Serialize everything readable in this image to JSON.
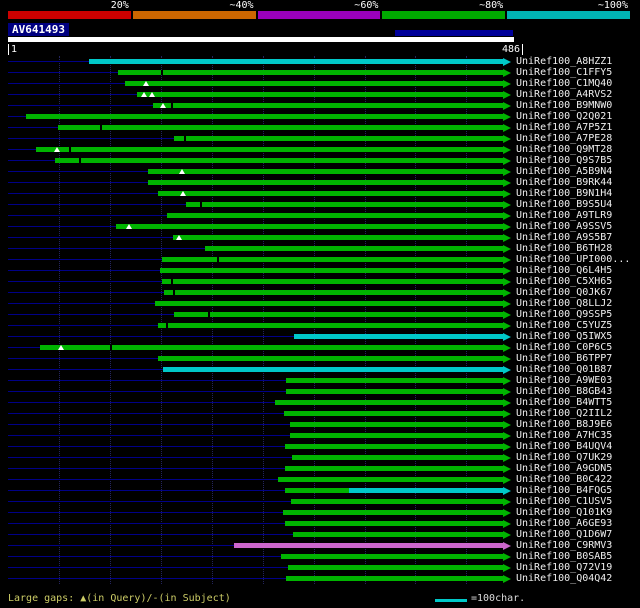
{
  "colors": {
    "background": "#000000",
    "green": "#00b400",
    "cyan": "#00c8c8",
    "magenta": "#cc66cc",
    "navy_line": "#000088",
    "query_bar": "#ffffff",
    "legend_text": "#cccc66"
  },
  "scale": {
    "segments": [
      {
        "label": "20%",
        "color": "#cc0000"
      },
      {
        "label": "~40%",
        "color": "#cc6600"
      },
      {
        "label": "~60%",
        "color": "#9900bb"
      },
      {
        "label": "~80%",
        "color": "#00aa00"
      },
      {
        "label": "~100%",
        "color": "#00b4b4"
      }
    ]
  },
  "query": {
    "name": "AV641493",
    "start_label": "1",
    "end_label": "486"
  },
  "legend": {
    "gaps": "Large gaps: ▲(in Query)/-(in Subject)",
    "unit": "=100char."
  },
  "chart_data": {
    "type": "bar",
    "subtype": "horizontal-alignment-spans",
    "title": "AV641493",
    "xlabel": "query position",
    "xlim": [
      1,
      486
    ],
    "grid_interval": 50,
    "legend_position": "top",
    "hits": [
      {
        "label": "UniRef100_A8HZZ1",
        "segments": [
          {
            "color": "cyan",
            "start": 79,
            "end": 486
          }
        ]
      },
      {
        "label": "UniRef100_C1FFY5",
        "segments": [
          {
            "color": "green",
            "start": 108,
            "end": 486
          }
        ],
        "s_gaps": [
          150
        ]
      },
      {
        "label": "UniRef100_C1MQ40",
        "segments": [
          {
            "color": "green",
            "start": 115,
            "end": 486
          }
        ],
        "q_gaps": [
          135
        ]
      },
      {
        "label": "UniRef100_A4RVS2",
        "segments": [
          {
            "color": "green",
            "start": 127,
            "end": 486
          }
        ],
        "q_gaps": [
          133,
          141
        ]
      },
      {
        "label": "UniRef100_B9MNW0",
        "segments": [
          {
            "color": "green",
            "start": 142,
            "end": 486
          }
        ],
        "q_gaps": [
          152
        ],
        "s_gaps": [
          160
        ]
      },
      {
        "label": "UniRef100_Q2Q021",
        "segments": [
          {
            "color": "green",
            "start": 18,
            "end": 486
          }
        ]
      },
      {
        "label": "UniRef100_A7P5Z1",
        "segments": [
          {
            "color": "green",
            "start": 49,
            "end": 486
          }
        ],
        "s_gaps": [
          90
        ]
      },
      {
        "label": "UniRef100_A7PE28",
        "segments": [
          {
            "color": "green",
            "start": 163,
            "end": 486
          }
        ],
        "s_gaps": [
          173
        ]
      },
      {
        "label": "UniRef100_Q9MT28",
        "segments": [
          {
            "color": "green",
            "start": 27,
            "end": 486
          }
        ],
        "q_gaps": [
          48
        ],
        "s_gaps": [
          60
        ]
      },
      {
        "label": "UniRef100_Q9S7B5",
        "segments": [
          {
            "color": "green",
            "start": 46,
            "end": 486
          }
        ],
        "s_gaps": [
          70
        ]
      },
      {
        "label": "UniRef100_A5B9N4",
        "segments": [
          {
            "color": "green",
            "start": 137,
            "end": 486
          }
        ],
        "q_gaps": [
          171
        ]
      },
      {
        "label": "UniRef100_B9RK44",
        "segments": [
          {
            "color": "green",
            "start": 137,
            "end": 486
          }
        ]
      },
      {
        "label": "UniRef100_B9N1H4",
        "segments": [
          {
            "color": "green",
            "start": 147,
            "end": 486
          }
        ],
        "q_gaps": [
          172
        ]
      },
      {
        "label": "UniRef100_B9S5U4",
        "segments": [
          {
            "color": "green",
            "start": 175,
            "end": 486
          }
        ],
        "s_gaps": [
          188
        ]
      },
      {
        "label": "UniRef100_A9TLR9",
        "segments": [
          {
            "color": "green",
            "start": 156,
            "end": 486
          }
        ]
      },
      {
        "label": "UniRef100_A9SSV5",
        "segments": [
          {
            "color": "green",
            "start": 106,
            "end": 486
          }
        ],
        "q_gaps": [
          119
        ]
      },
      {
        "label": "UniRef100_A9S5B7",
        "segments": [
          {
            "color": "green",
            "start": 162,
            "end": 486
          }
        ],
        "q_gaps": [
          168
        ]
      },
      {
        "label": "UniRef100_B6TH28",
        "segments": [
          {
            "color": "green",
            "start": 193,
            "end": 486
          }
        ]
      },
      {
        "label": "UniRef100_UPI000...",
        "segments": [
          {
            "color": "green",
            "start": 151,
            "end": 486
          }
        ],
        "s_gaps": [
          205
        ]
      },
      {
        "label": "UniRef100_Q6L4H5",
        "segments": [
          {
            "color": "green",
            "start": 149,
            "end": 486
          }
        ]
      },
      {
        "label": "UniRef100_C5XH65",
        "segments": [
          {
            "color": "green",
            "start": 151,
            "end": 486
          }
        ],
        "s_gaps": [
          160
        ]
      },
      {
        "label": "UniRef100_Q0JK67",
        "segments": [
          {
            "color": "green",
            "start": 153,
            "end": 486
          }
        ],
        "s_gaps": [
          162
        ]
      },
      {
        "label": "UniRef100_Q8LLJ2",
        "segments": [
          {
            "color": "green",
            "start": 144,
            "end": 486
          }
        ]
      },
      {
        "label": "UniRef100_Q9SSP5",
        "segments": [
          {
            "color": "green",
            "start": 163,
            "end": 486
          }
        ],
        "s_gaps": [
          196
        ]
      },
      {
        "label": "UniRef100_C5YUZ5",
        "segments": [
          {
            "color": "green",
            "start": 147,
            "end": 486
          }
        ],
        "s_gaps": [
          155
        ]
      },
      {
        "label": "UniRef100_Q5IWX5",
        "segments": [
          {
            "color": "cyan",
            "start": 281,
            "end": 486
          }
        ]
      },
      {
        "label": "UniRef100_C0P6C5",
        "segments": [
          {
            "color": "green",
            "start": 31,
            "end": 486
          }
        ],
        "q_gaps": [
          52
        ],
        "s_gaps": [
          100
        ]
      },
      {
        "label": "UniRef100_B6TPP7",
        "segments": [
          {
            "color": "green",
            "start": 147,
            "end": 486
          }
        ]
      },
      {
        "label": "UniRef100_Q01B87",
        "segments": [
          {
            "color": "cyan",
            "start": 152,
            "end": 486
          }
        ]
      },
      {
        "label": "UniRef100_A9WE03",
        "segments": [
          {
            "color": "green",
            "start": 273,
            "end": 486
          }
        ]
      },
      {
        "label": "UniRef100_B8GB43",
        "segments": [
          {
            "color": "green",
            "start": 273,
            "end": 486
          }
        ]
      },
      {
        "label": "UniRef100_B4WTT5",
        "segments": [
          {
            "color": "green",
            "start": 262,
            "end": 486
          }
        ]
      },
      {
        "label": "UniRef100_Q2IIL2",
        "segments": [
          {
            "color": "green",
            "start": 271,
            "end": 486
          }
        ]
      },
      {
        "label": "UniRef100_B8J9E6",
        "segments": [
          {
            "color": "green",
            "start": 277,
            "end": 486
          }
        ]
      },
      {
        "label": "UniRef100_A7HC35",
        "segments": [
          {
            "color": "green",
            "start": 277,
            "end": 486
          }
        ]
      },
      {
        "label": "UniRef100_B4UQV4",
        "segments": [
          {
            "color": "green",
            "start": 272,
            "end": 486
          }
        ]
      },
      {
        "label": "UniRef100_Q7UK29",
        "segments": [
          {
            "color": "green",
            "start": 279,
            "end": 486
          }
        ]
      },
      {
        "label": "UniRef100_A9GDN5",
        "segments": [
          {
            "color": "green",
            "start": 272,
            "end": 486
          }
        ]
      },
      {
        "label": "UniRef100_B0C422",
        "segments": [
          {
            "color": "green",
            "start": 265,
            "end": 486
          }
        ]
      },
      {
        "label": "UniRef100_B4FQG5",
        "segments": [
          {
            "color": "green",
            "start": 272,
            "end": 335
          },
          {
            "color": "cyan",
            "start": 335,
            "end": 486
          }
        ]
      },
      {
        "label": "UniRef100_C1USV5",
        "segments": [
          {
            "color": "green",
            "start": 278,
            "end": 486
          }
        ]
      },
      {
        "label": "UniRef100_Q101K9",
        "segments": [
          {
            "color": "green",
            "start": 270,
            "end": 486
          }
        ]
      },
      {
        "label": "UniRef100_A6GE93",
        "segments": [
          {
            "color": "green",
            "start": 272,
            "end": 486
          }
        ]
      },
      {
        "label": "UniRef100_Q1D6W7",
        "segments": [
          {
            "color": "green",
            "start": 280,
            "end": 486
          }
        ]
      },
      {
        "label": "UniRef100_C9RMV3",
        "segments": [
          {
            "color": "magenta",
            "start": 222,
            "end": 486
          }
        ]
      },
      {
        "label": "UniRef100_B0SAB5",
        "segments": [
          {
            "color": "green",
            "start": 268,
            "end": 486
          }
        ]
      },
      {
        "label": "UniRef100_Q72V19",
        "segments": [
          {
            "color": "green",
            "start": 275,
            "end": 486
          }
        ]
      },
      {
        "label": "UniRef100_Q04Q42",
        "segments": [
          {
            "color": "green",
            "start": 273,
            "end": 486
          }
        ]
      }
    ]
  }
}
